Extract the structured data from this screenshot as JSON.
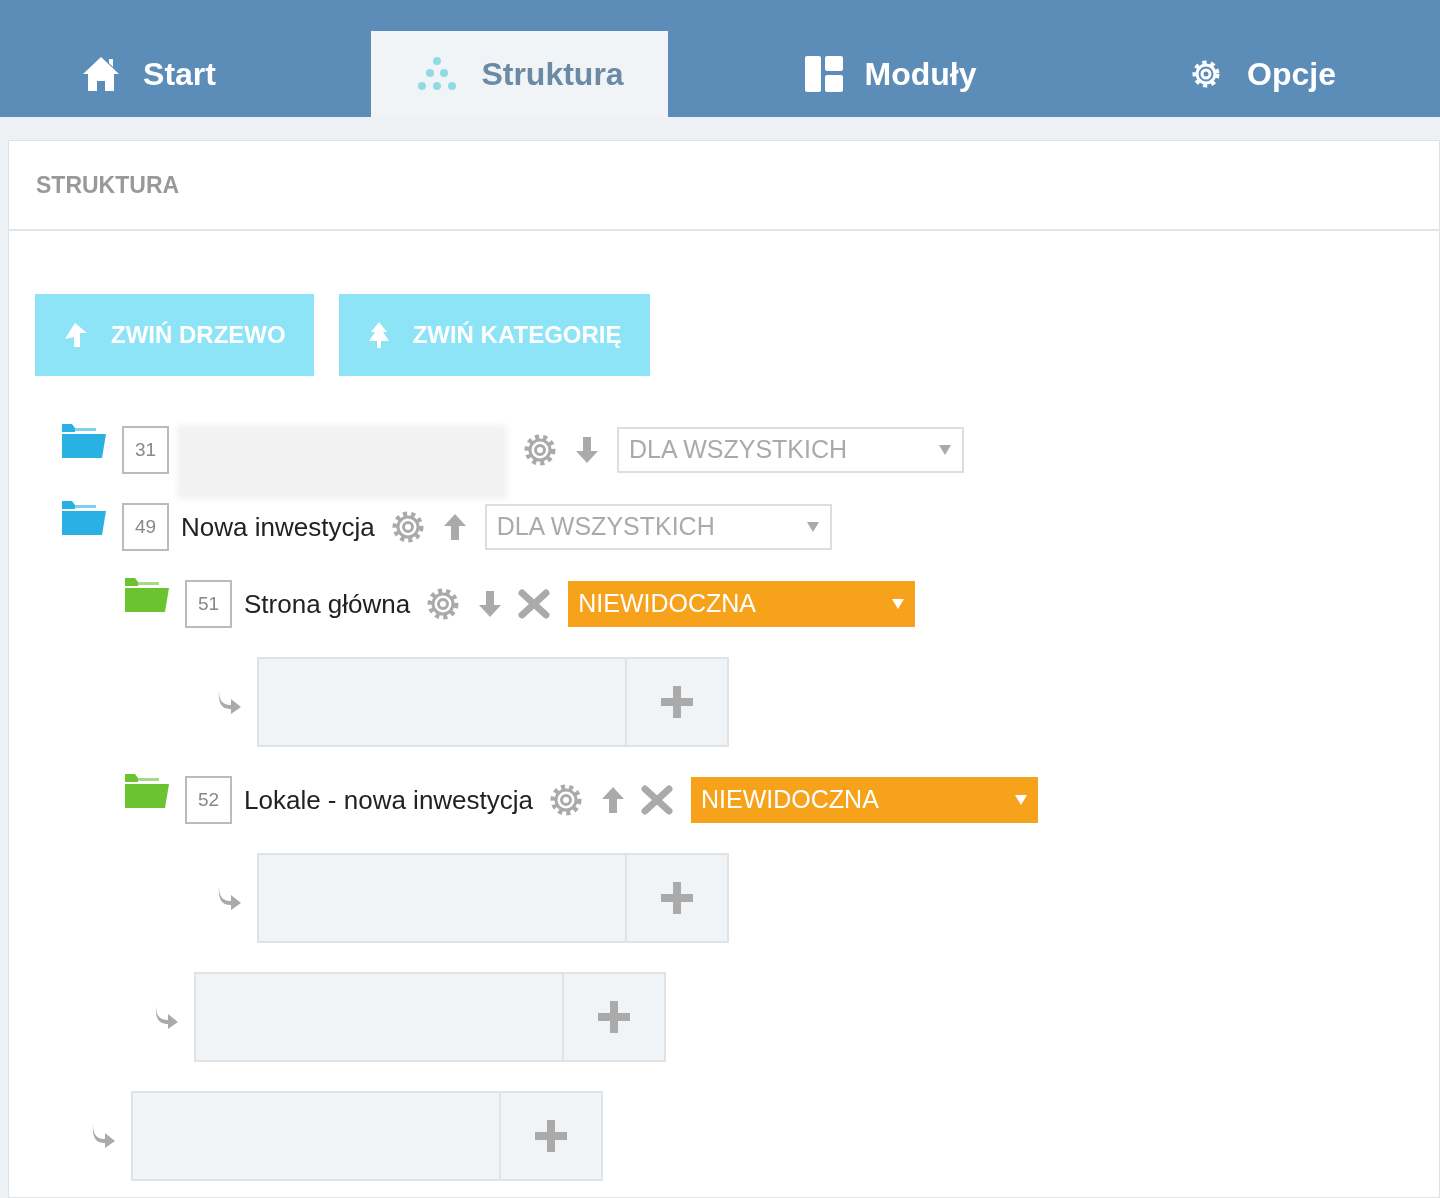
{
  "tabs": [
    {
      "label": "Start",
      "selected": false
    },
    {
      "label": "Struktura",
      "selected": true
    },
    {
      "label": "Moduły",
      "selected": false
    },
    {
      "label": "Opcje",
      "selected": false
    }
  ],
  "panel": {
    "title": "STRUKTURA"
  },
  "buttons": [
    {
      "label": "ZWIŃ DRZEWO"
    },
    {
      "label": "ZWIŃ KATEGORIĘ"
    }
  ],
  "tree": [
    {
      "kind": "category",
      "id": "31",
      "moves_up": false,
      "deletable": false,
      "visibility": {
        "value": "DLA WSZYSTKICH",
        "kind": "public"
      }
    },
    {
      "kind": "category",
      "id": "49",
      "name": "Nowa inwestycja",
      "moves_up": true,
      "deletable": false,
      "visibility": {
        "value": "DLA WSZYSTKICH",
        "kind": "public"
      },
      "children": [
        {
          "kind": "page",
          "id": "51",
          "name": "Strona główna",
          "moves_up": false,
          "deletable": true,
          "visibility": {
            "value": "NIEWIDOCZNA",
            "kind": "hidden"
          },
          "children": [
            {
              "kind": "add"
            }
          ]
        },
        {
          "kind": "page",
          "id": "52",
          "name": "Lokale - nowa inwestycja",
          "moves_up": true,
          "deletable": true,
          "visibility": {
            "value": "NIEWIDOCZNA",
            "kind": "hidden"
          },
          "children": [
            {
              "kind": "add"
            }
          ]
        },
        {
          "kind": "add"
        }
      ]
    },
    {
      "kind": "add"
    }
  ]
}
